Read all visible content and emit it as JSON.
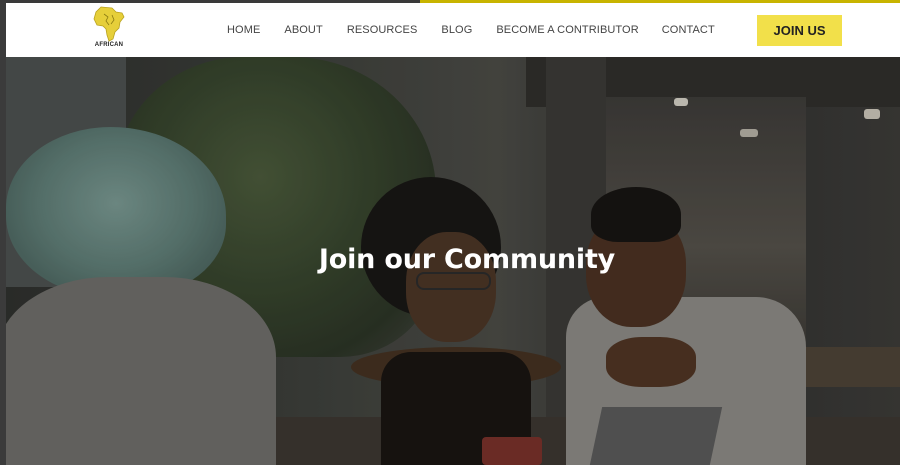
{
  "brand": {
    "logo_text": "AFRICAN",
    "logo_icon": "africa-map-icon",
    "accent_color": "#f2e04a"
  },
  "nav": {
    "items": [
      {
        "label": "HOME"
      },
      {
        "label": "ABOUT"
      },
      {
        "label": "RESOURCES"
      },
      {
        "label": "BLOG"
      },
      {
        "label": "BECOME A CONTRIBUTOR"
      },
      {
        "label": "CONTACT"
      }
    ],
    "cta_label": "JOIN US"
  },
  "hero": {
    "title": "Join our Community"
  }
}
